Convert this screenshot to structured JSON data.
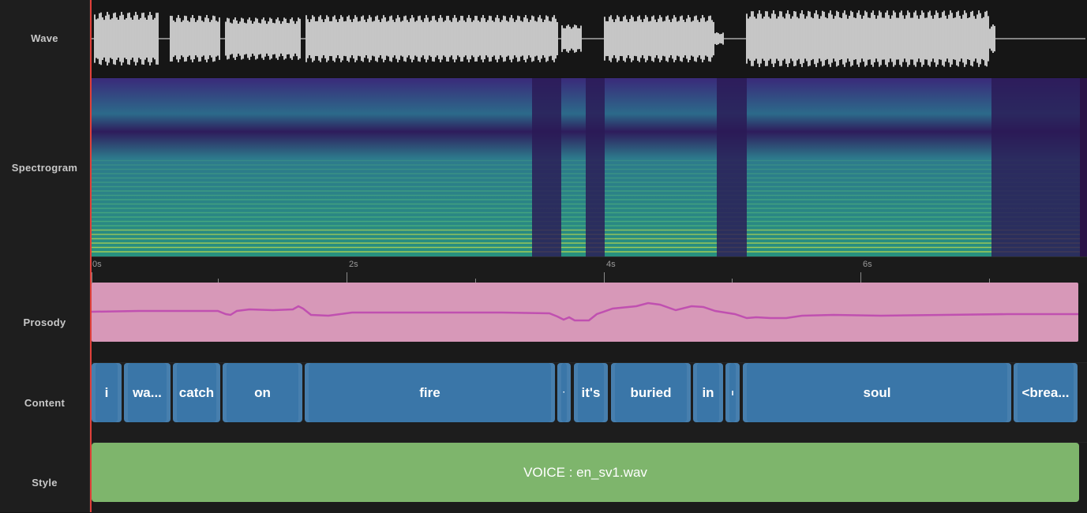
{
  "rows": {
    "wave": "Wave",
    "spectrogram": "Spectrogram",
    "prosody": "Prosody",
    "content": "Content",
    "style": "Style"
  },
  "ruler": {
    "labels": [
      "0s",
      "2s",
      "4s",
      "6s"
    ]
  },
  "content": {
    "words": [
      {
        "text": "i"
      },
      {
        "text": "wa..."
      },
      {
        "text": "catch"
      },
      {
        "text": "on"
      },
      {
        "text": "fire"
      },
      {
        "text": "·"
      },
      {
        "text": "it's"
      },
      {
        "text": "buried"
      },
      {
        "text": "in"
      },
      {
        "text": "ı"
      },
      {
        "text": "soul"
      },
      {
        "text": "<brea..."
      }
    ]
  },
  "style": {
    "label": "VOICE : en_sv1.wav"
  },
  "colors": {
    "playhead": "#e0403a",
    "prosody_fill": "#d798b8",
    "prosody_line": "#c050b0",
    "word_block": "#3a76a8",
    "style_block": "#7eb56c",
    "wave": "#f2f2f2"
  }
}
